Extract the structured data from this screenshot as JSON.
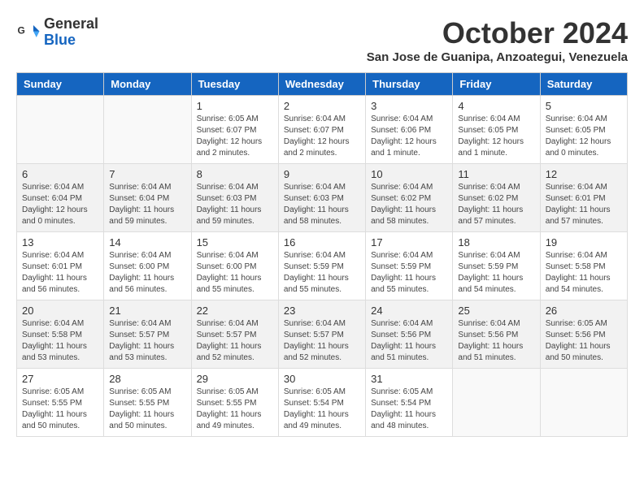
{
  "header": {
    "logo_general": "General",
    "logo_blue": "Blue",
    "month_title": "October 2024",
    "location": "San Jose de Guanipa, Anzoategui, Venezuela"
  },
  "days_of_week": [
    "Sunday",
    "Monday",
    "Tuesday",
    "Wednesday",
    "Thursday",
    "Friday",
    "Saturday"
  ],
  "weeks": [
    [
      {
        "day": "",
        "info": ""
      },
      {
        "day": "",
        "info": ""
      },
      {
        "day": "1",
        "info": "Sunrise: 6:05 AM\nSunset: 6:07 PM\nDaylight: 12 hours\nand 2 minutes."
      },
      {
        "day": "2",
        "info": "Sunrise: 6:04 AM\nSunset: 6:07 PM\nDaylight: 12 hours\nand 2 minutes."
      },
      {
        "day": "3",
        "info": "Sunrise: 6:04 AM\nSunset: 6:06 PM\nDaylight: 12 hours\nand 1 minute."
      },
      {
        "day": "4",
        "info": "Sunrise: 6:04 AM\nSunset: 6:05 PM\nDaylight: 12 hours\nand 1 minute."
      },
      {
        "day": "5",
        "info": "Sunrise: 6:04 AM\nSunset: 6:05 PM\nDaylight: 12 hours\nand 0 minutes."
      }
    ],
    [
      {
        "day": "6",
        "info": "Sunrise: 6:04 AM\nSunset: 6:04 PM\nDaylight: 12 hours\nand 0 minutes."
      },
      {
        "day": "7",
        "info": "Sunrise: 6:04 AM\nSunset: 6:04 PM\nDaylight: 11 hours\nand 59 minutes."
      },
      {
        "day": "8",
        "info": "Sunrise: 6:04 AM\nSunset: 6:03 PM\nDaylight: 11 hours\nand 59 minutes."
      },
      {
        "day": "9",
        "info": "Sunrise: 6:04 AM\nSunset: 6:03 PM\nDaylight: 11 hours\nand 58 minutes."
      },
      {
        "day": "10",
        "info": "Sunrise: 6:04 AM\nSunset: 6:02 PM\nDaylight: 11 hours\nand 58 minutes."
      },
      {
        "day": "11",
        "info": "Sunrise: 6:04 AM\nSunset: 6:02 PM\nDaylight: 11 hours\nand 57 minutes."
      },
      {
        "day": "12",
        "info": "Sunrise: 6:04 AM\nSunset: 6:01 PM\nDaylight: 11 hours\nand 57 minutes."
      }
    ],
    [
      {
        "day": "13",
        "info": "Sunrise: 6:04 AM\nSunset: 6:01 PM\nDaylight: 11 hours\nand 56 minutes."
      },
      {
        "day": "14",
        "info": "Sunrise: 6:04 AM\nSunset: 6:00 PM\nDaylight: 11 hours\nand 56 minutes."
      },
      {
        "day": "15",
        "info": "Sunrise: 6:04 AM\nSunset: 6:00 PM\nDaylight: 11 hours\nand 55 minutes."
      },
      {
        "day": "16",
        "info": "Sunrise: 6:04 AM\nSunset: 5:59 PM\nDaylight: 11 hours\nand 55 minutes."
      },
      {
        "day": "17",
        "info": "Sunrise: 6:04 AM\nSunset: 5:59 PM\nDaylight: 11 hours\nand 55 minutes."
      },
      {
        "day": "18",
        "info": "Sunrise: 6:04 AM\nSunset: 5:59 PM\nDaylight: 11 hours\nand 54 minutes."
      },
      {
        "day": "19",
        "info": "Sunrise: 6:04 AM\nSunset: 5:58 PM\nDaylight: 11 hours\nand 54 minutes."
      }
    ],
    [
      {
        "day": "20",
        "info": "Sunrise: 6:04 AM\nSunset: 5:58 PM\nDaylight: 11 hours\nand 53 minutes."
      },
      {
        "day": "21",
        "info": "Sunrise: 6:04 AM\nSunset: 5:57 PM\nDaylight: 11 hours\nand 53 minutes."
      },
      {
        "day": "22",
        "info": "Sunrise: 6:04 AM\nSunset: 5:57 PM\nDaylight: 11 hours\nand 52 minutes."
      },
      {
        "day": "23",
        "info": "Sunrise: 6:04 AM\nSunset: 5:57 PM\nDaylight: 11 hours\nand 52 minutes."
      },
      {
        "day": "24",
        "info": "Sunrise: 6:04 AM\nSunset: 5:56 PM\nDaylight: 11 hours\nand 51 minutes."
      },
      {
        "day": "25",
        "info": "Sunrise: 6:04 AM\nSunset: 5:56 PM\nDaylight: 11 hours\nand 51 minutes."
      },
      {
        "day": "26",
        "info": "Sunrise: 6:05 AM\nSunset: 5:56 PM\nDaylight: 11 hours\nand 50 minutes."
      }
    ],
    [
      {
        "day": "27",
        "info": "Sunrise: 6:05 AM\nSunset: 5:55 PM\nDaylight: 11 hours\nand 50 minutes."
      },
      {
        "day": "28",
        "info": "Sunrise: 6:05 AM\nSunset: 5:55 PM\nDaylight: 11 hours\nand 50 minutes."
      },
      {
        "day": "29",
        "info": "Sunrise: 6:05 AM\nSunset: 5:55 PM\nDaylight: 11 hours\nand 49 minutes."
      },
      {
        "day": "30",
        "info": "Sunrise: 6:05 AM\nSunset: 5:54 PM\nDaylight: 11 hours\nand 49 minutes."
      },
      {
        "day": "31",
        "info": "Sunrise: 6:05 AM\nSunset: 5:54 PM\nDaylight: 11 hours\nand 48 minutes."
      },
      {
        "day": "",
        "info": ""
      },
      {
        "day": "",
        "info": ""
      }
    ]
  ]
}
